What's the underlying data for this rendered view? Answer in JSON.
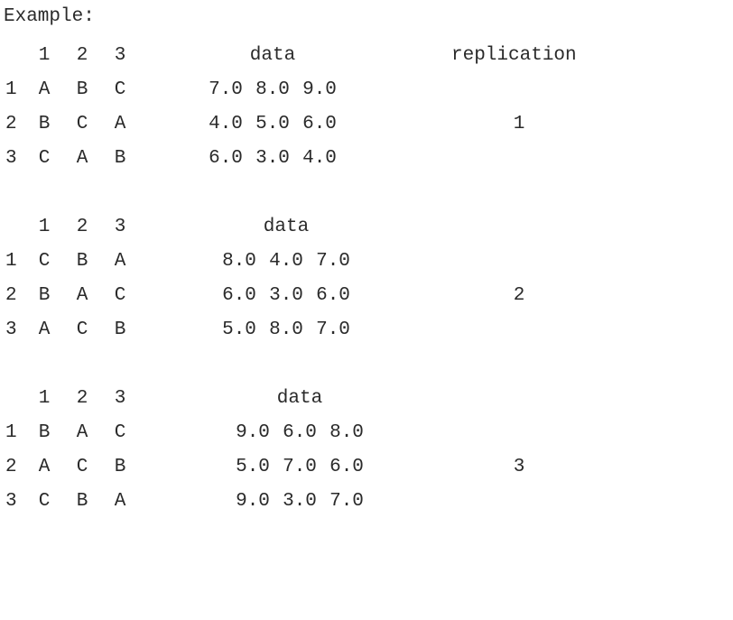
{
  "title": "Example:",
  "headers": {
    "cols": [
      "1",
      "2",
      "3"
    ],
    "data": "data",
    "replication": "replication"
  },
  "blocks": [
    {
      "replication": "1",
      "rows": [
        {
          "r": "1",
          "design": [
            "A",
            "B",
            "C"
          ],
          "data": [
            "7.0",
            "8.0",
            "9.0"
          ]
        },
        {
          "r": "2",
          "design": [
            "B",
            "C",
            "A"
          ],
          "data": [
            "4.0",
            "5.0",
            "6.0"
          ]
        },
        {
          "r": "3",
          "design": [
            "C",
            "A",
            "B"
          ],
          "data": [
            "6.0",
            "3.0",
            "4.0"
          ]
        }
      ]
    },
    {
      "replication": "2",
      "rows": [
        {
          "r": "1",
          "design": [
            "C",
            "B",
            "A"
          ],
          "data": [
            "8.0",
            "4.0",
            "7.0"
          ]
        },
        {
          "r": "2",
          "design": [
            "B",
            "A",
            "C"
          ],
          "data": [
            "6.0",
            "3.0",
            "6.0"
          ]
        },
        {
          "r": "3",
          "design": [
            "A",
            "C",
            "B"
          ],
          "data": [
            "5.0",
            "8.0",
            "7.0"
          ]
        }
      ]
    },
    {
      "replication": "3",
      "rows": [
        {
          "r": "1",
          "design": [
            "B",
            "A",
            "C"
          ],
          "data": [
            "9.0",
            "6.0",
            "8.0"
          ]
        },
        {
          "r": "2",
          "design": [
            "A",
            "C",
            "B"
          ],
          "data": [
            "5.0",
            "7.0",
            "6.0"
          ]
        },
        {
          "r": "3",
          "design": [
            "C",
            "B",
            "A"
          ],
          "data": [
            "9.0",
            "3.0",
            "7.0"
          ]
        }
      ]
    }
  ]
}
